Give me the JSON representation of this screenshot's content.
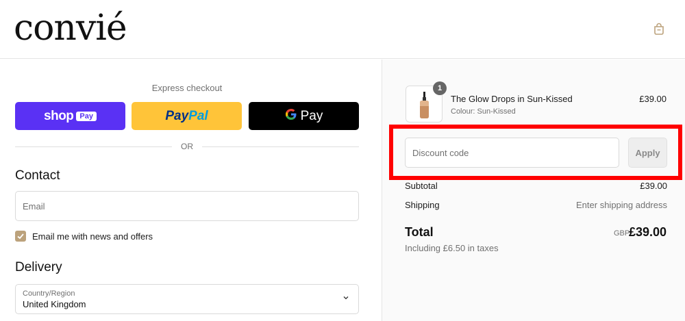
{
  "header": {
    "logo_text": "convié",
    "cart_icon": "shopping-bag-icon"
  },
  "checkout": {
    "express_title": "Express checkout",
    "express_buttons": [
      {
        "brand": "shop",
        "label": "shop",
        "badge": "Pay",
        "bg": "#5a31f4"
      },
      {
        "brand": "paypal",
        "label_part1": "Pay",
        "label_part2": "Pal",
        "bg": "#ffc439"
      },
      {
        "brand": "gpay",
        "g": "G",
        "label": "Pay",
        "bg": "#000000"
      }
    ],
    "or_text": "OR",
    "contact": {
      "title": "Contact",
      "email_placeholder": "Email",
      "newsletter_label": "Email me with news and offers",
      "newsletter_checked": true
    },
    "delivery": {
      "title": "Delivery",
      "country_label": "Country/Region",
      "country_value": "United Kingdom"
    }
  },
  "order_summary": {
    "product": {
      "name": "The Glow Drops in Sun-Kissed",
      "variant": "Colour: Sun-Kissed",
      "price": "£39.00",
      "quantity": "1"
    },
    "discount": {
      "placeholder": "Discount code",
      "apply_label": "Apply"
    },
    "subtotal_label": "Subtotal",
    "subtotal_value": "£39.00",
    "shipping_label": "Shipping",
    "shipping_value": "Enter shipping address",
    "total_label": "Total",
    "total_currency": "GBP",
    "total_value": "£39.00",
    "taxes_note": "Including £6.50 in taxes"
  },
  "colors": {
    "accent": "#bca27c",
    "highlight": "#ff0000"
  }
}
